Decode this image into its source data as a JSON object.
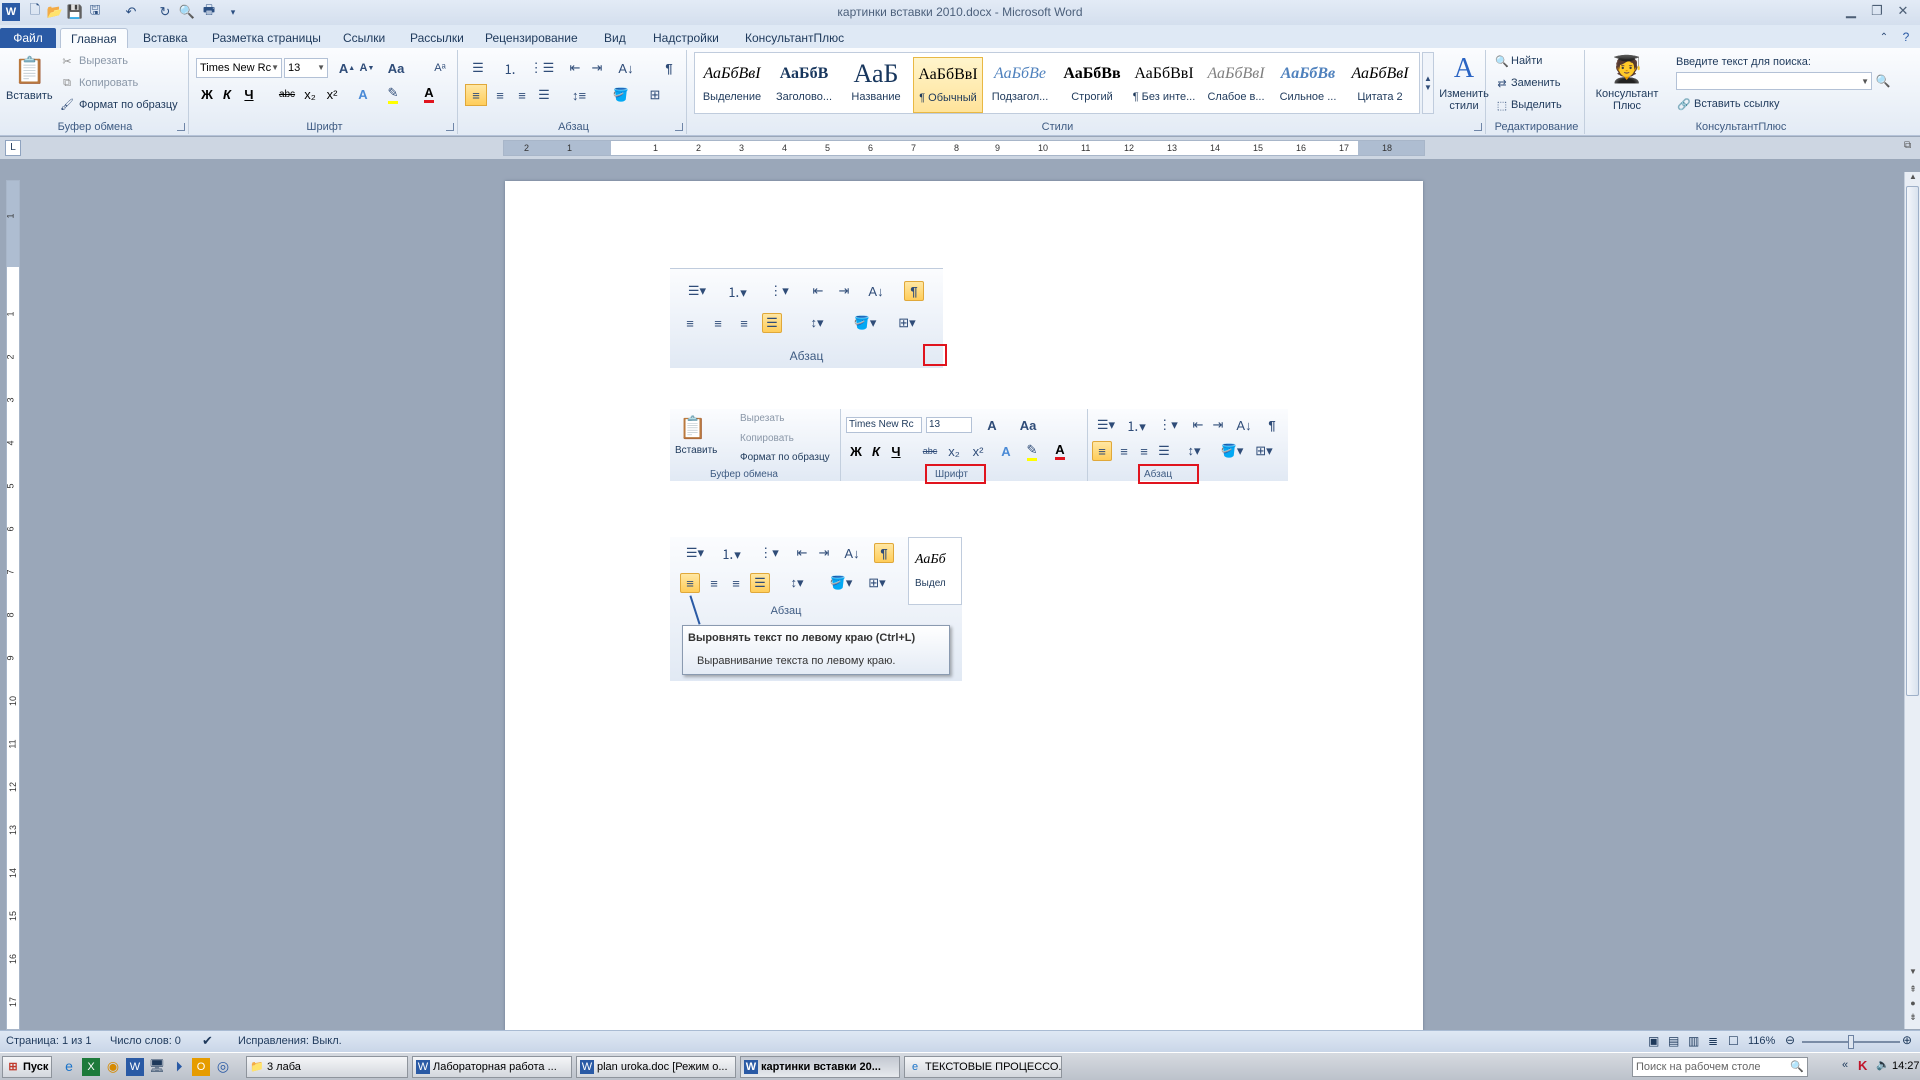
{
  "window": {
    "title": "картинки вставки 2010.docx - Microsoft Word"
  },
  "tabs": [
    "Файл",
    "Главная",
    "Вставка",
    "Разметка страницы",
    "Ссылки",
    "Рассылки",
    "Рецензирование",
    "Вид",
    "Надстройки",
    "КонсультантПлюс"
  ],
  "clipboard": {
    "paste": "Вставить",
    "cut": "Вырезать",
    "copy": "Копировать",
    "format_painter": "Формат по образцу",
    "label": "Буфер обмена"
  },
  "font": {
    "name": "Times New Rc",
    "size": "13",
    "label": "Шрифт",
    "bold": "Ж",
    "italic": "К",
    "underline": "Ч",
    "strike": "abc",
    "sub": "x₂",
    "sup": "x²",
    "case": "Aa"
  },
  "paragraph": {
    "label": "Абзац"
  },
  "styles": {
    "label": "Стили",
    "items": [
      {
        "sample": "АаБбВвІ",
        "name": "Выделение"
      },
      {
        "sample": "АаБбВ",
        "name": "Заголово..."
      },
      {
        "sample": "АаБ",
        "name": "Название"
      },
      {
        "sample": "АаБбВвІ",
        "name": "¶ Обычный"
      },
      {
        "sample": "АаБбВе",
        "name": "Подзагол..."
      },
      {
        "sample": "АаБбВв",
        "name": "Строгий"
      },
      {
        "sample": "АаБбВвІ",
        "name": "¶ Без инте..."
      },
      {
        "sample": "АаБбВвІ",
        "name": "Слабое в..."
      },
      {
        "sample": "АаБбВв",
        "name": "Сильное ..."
      },
      {
        "sample": "АаБбВвІ",
        "name": "Цитата 2"
      }
    ],
    "change": "Изменить стили"
  },
  "editing": {
    "find": "Найти",
    "replace": "Заменить",
    "select": "Выделить",
    "label": "Редактирование"
  },
  "consultant": {
    "button": "Консультант Плюс",
    "search_label": "Введите текст для поиска:",
    "insert_link": "Вставить ссылку",
    "label": "КонсультантПлюс"
  },
  "ruler": {
    "h_ticks": [
      "2",
      "1",
      "1",
      "2",
      "3",
      "4",
      "5",
      "6",
      "7",
      "8",
      "9",
      "10",
      "11",
      "12",
      "13",
      "14",
      "15",
      "16",
      "17",
      "18"
    ],
    "v_ticks": [
      "1",
      "1",
      "2",
      "3",
      "4",
      "5",
      "6",
      "7",
      "8",
      "9",
      "10",
      "11",
      "12",
      "13",
      "14",
      "15",
      "16",
      "17"
    ]
  },
  "doc": {
    "img1": {
      "label": "Абзац"
    },
    "img2": {
      "paste": "Вставить",
      "cut": "Вырезать",
      "copy": "Копировать",
      "format_painter": "Формат по образцу",
      "font_name": "Times New Rc",
      "font_size": "13",
      "clipboard_label": "Буфер обмена",
      "font_label": "Шрифт",
      "paragraph_label": "Абзац"
    },
    "img3": {
      "label": "Абзац",
      "style_sample": "АаБб",
      "style_name": "Выдел",
      "tooltip_title": "Выровнять текст по левому краю (Ctrl+L)",
      "tooltip_text": "Выравнивание текста по левому краю."
    }
  },
  "status": {
    "page": "Страница: 1 из 1",
    "words": "Число слов: 0",
    "track": "Исправления: Выкл.",
    "zoom": "116%"
  },
  "taskbar": {
    "start": "Пуск",
    "items": [
      "3 лаба",
      "Лабораторная работа ...",
      "plan uroka.doc [Режим о...",
      "картинки вставки 20...",
      "ТЕКСТОВЫЕ ПРОЦЕССО..."
    ],
    "search_placeholder": "Поиск на рабочем столе",
    "time": "14:27"
  },
  "colors": {
    "accent": "#2a5aa5",
    "highlight": "#ffcd5a",
    "red_frame": "#e0141e"
  }
}
